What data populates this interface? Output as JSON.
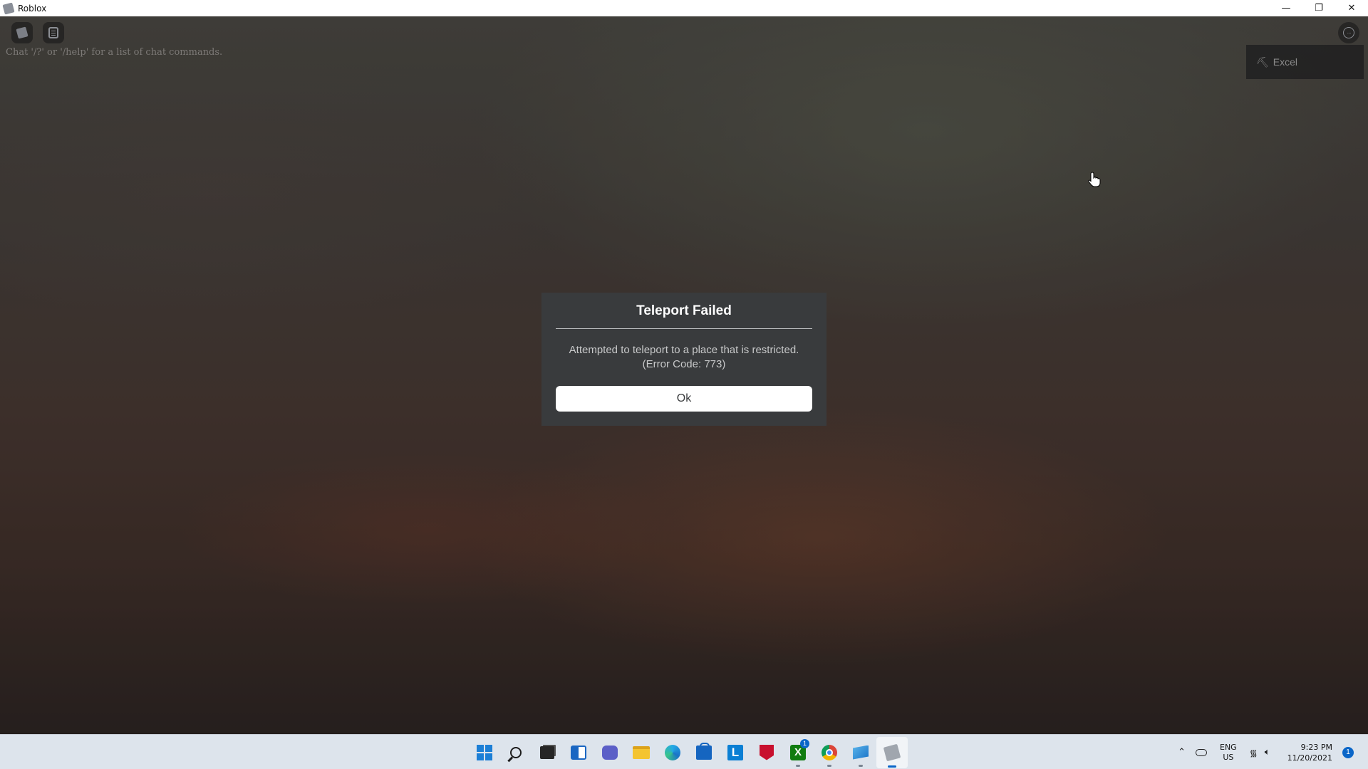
{
  "window": {
    "title": "Roblox",
    "controls": {
      "minimize": "—",
      "restore": "❐",
      "close": "✕"
    }
  },
  "game": {
    "chat_hint": "Chat '/?' or '/help' for a list of chat commands.",
    "excel_badge": "Excel",
    "top_buttons": [
      "roblox-menu-icon",
      "chat-icon",
      "more-options-icon"
    ]
  },
  "dialog": {
    "title": "Teleport Failed",
    "message_line1": "Attempted to teleport to a place that is restricted.",
    "message_line2": "(Error Code: 773)",
    "ok_label": "Ok"
  },
  "taskbar": {
    "apps": [
      "start",
      "search",
      "task-view",
      "widgets",
      "teams-chat",
      "file-explorer",
      "edge",
      "microsoft-store",
      "l-app",
      "mcafee",
      "xbox",
      "chrome",
      "snipping-tool",
      "roblox"
    ],
    "xbox_badge": "1",
    "active_app": "roblox"
  },
  "tray": {
    "lang_line1": "ENG",
    "lang_line2": "US",
    "time": "9:23 PM",
    "date": "11/20/2021",
    "notification_count": "1"
  },
  "colors": {
    "dialog_bg": "#393b3d",
    "ok_button_bg": "#ffffff",
    "taskbar_bg": "#dde4ec",
    "accent": "#0a66c8"
  }
}
